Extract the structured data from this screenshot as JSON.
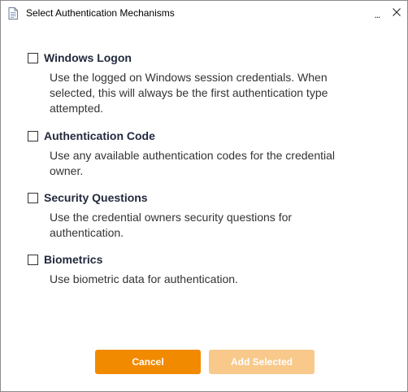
{
  "window": {
    "title": "Select Authentication Mechanisms",
    "more_label": "...",
    "icons": {
      "title": "document-icon",
      "close": "close-icon"
    }
  },
  "options": [
    {
      "title": "Windows Logon",
      "description": "Use the logged on Windows session credentials. When selected, this will always be the first authentication type attempted.",
      "checked": false
    },
    {
      "title": "Authentication Code",
      "description": "Use any available authentication codes for the credential owner.",
      "checked": false
    },
    {
      "title": "Security Questions",
      "description": "Use the credential owners security questions for authentication.",
      "checked": false
    },
    {
      "title": "Biometrics",
      "description": "Use biometric data for authentication.",
      "checked": false
    }
  ],
  "buttons": {
    "cancel": "Cancel",
    "add_selected": "Add Selected",
    "add_selected_enabled": false
  },
  "colors": {
    "accent": "#f28a00",
    "accent_disabled": "#f8c98a",
    "title_text": "#222a3d",
    "body_text": "#333333"
  }
}
